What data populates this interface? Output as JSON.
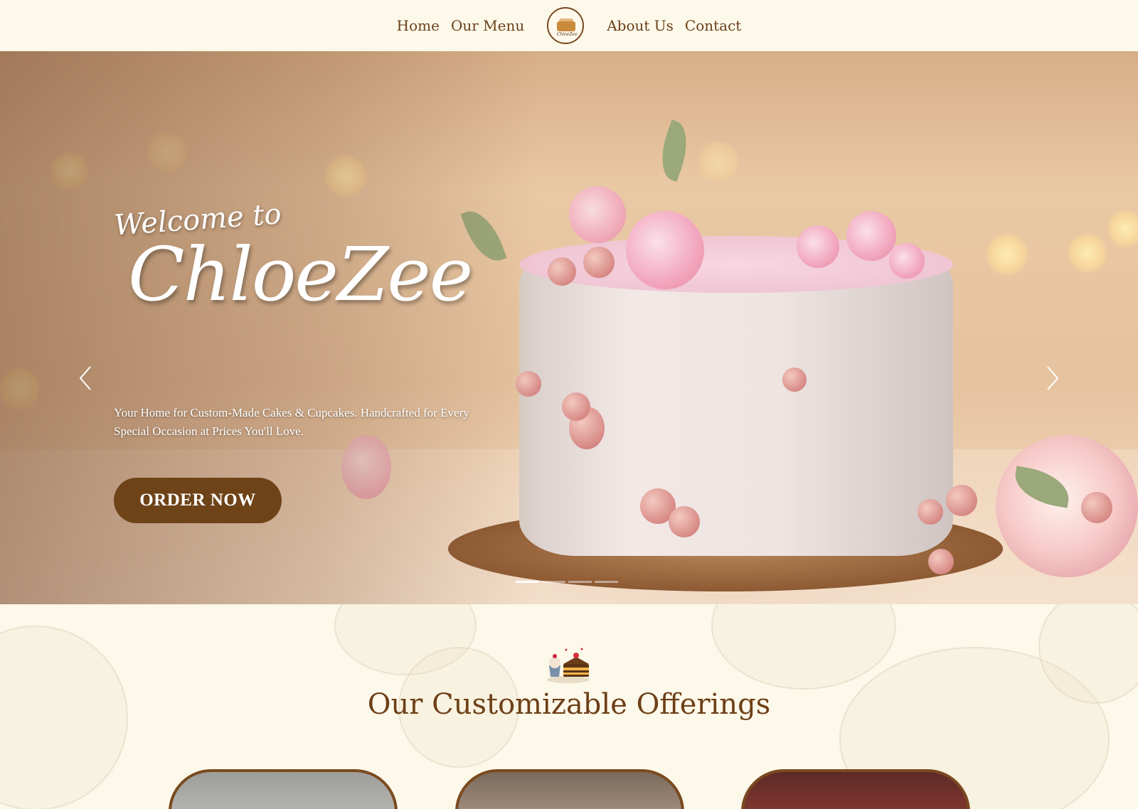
{
  "nav": {
    "left_links": [
      "Home",
      "Our Menu"
    ],
    "right_links": [
      "About Us",
      "Contact"
    ],
    "logo_text": "ChloeZee"
  },
  "hero": {
    "welcome": "Welcome to",
    "brand": "ChloeZee",
    "tagline": "Your Home for Custom-Made Cakes & Cupcakes. Handcrafted for Every Special Occasion at Prices You'll Love.",
    "cta": "ORDER NOW",
    "prev_icon": "chevron-left-icon",
    "next_icon": "chevron-right-icon",
    "slides": 4,
    "active_slide": 1
  },
  "offerings": {
    "title": "Our Customizable Offerings",
    "icon": "cake-icon"
  },
  "colors": {
    "brand_brown": "#6e4318",
    "cream": "#fdf9ea",
    "title_brown": "#6e3f16"
  }
}
